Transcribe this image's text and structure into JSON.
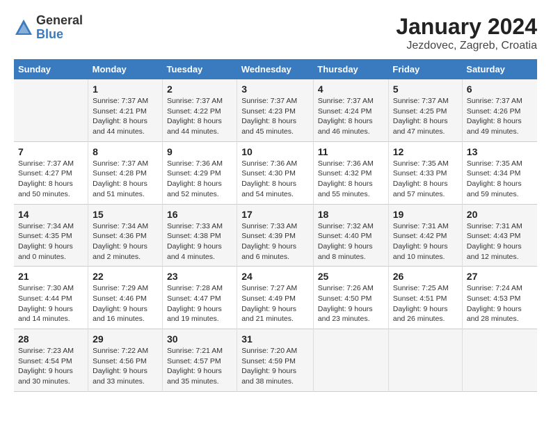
{
  "logo": {
    "general": "General",
    "blue": "Blue"
  },
  "title": "January 2024",
  "subtitle": "Jezdovec, Zagreb, Croatia",
  "days_of_week": [
    "Sunday",
    "Monday",
    "Tuesday",
    "Wednesday",
    "Thursday",
    "Friday",
    "Saturday"
  ],
  "weeks": [
    [
      {
        "day": "",
        "info": ""
      },
      {
        "day": "1",
        "info": "Sunrise: 7:37 AM\nSunset: 4:21 PM\nDaylight: 8 hours\nand 44 minutes."
      },
      {
        "day": "2",
        "info": "Sunrise: 7:37 AM\nSunset: 4:22 PM\nDaylight: 8 hours\nand 44 minutes."
      },
      {
        "day": "3",
        "info": "Sunrise: 7:37 AM\nSunset: 4:23 PM\nDaylight: 8 hours\nand 45 minutes."
      },
      {
        "day": "4",
        "info": "Sunrise: 7:37 AM\nSunset: 4:24 PM\nDaylight: 8 hours\nand 46 minutes."
      },
      {
        "day": "5",
        "info": "Sunrise: 7:37 AM\nSunset: 4:25 PM\nDaylight: 8 hours\nand 47 minutes."
      },
      {
        "day": "6",
        "info": "Sunrise: 7:37 AM\nSunset: 4:26 PM\nDaylight: 8 hours\nand 49 minutes."
      }
    ],
    [
      {
        "day": "7",
        "info": "Sunrise: 7:37 AM\nSunset: 4:27 PM\nDaylight: 8 hours\nand 50 minutes."
      },
      {
        "day": "8",
        "info": "Sunrise: 7:37 AM\nSunset: 4:28 PM\nDaylight: 8 hours\nand 51 minutes."
      },
      {
        "day": "9",
        "info": "Sunrise: 7:36 AM\nSunset: 4:29 PM\nDaylight: 8 hours\nand 52 minutes."
      },
      {
        "day": "10",
        "info": "Sunrise: 7:36 AM\nSunset: 4:30 PM\nDaylight: 8 hours\nand 54 minutes."
      },
      {
        "day": "11",
        "info": "Sunrise: 7:36 AM\nSunset: 4:32 PM\nDaylight: 8 hours\nand 55 minutes."
      },
      {
        "day": "12",
        "info": "Sunrise: 7:35 AM\nSunset: 4:33 PM\nDaylight: 8 hours\nand 57 minutes."
      },
      {
        "day": "13",
        "info": "Sunrise: 7:35 AM\nSunset: 4:34 PM\nDaylight: 8 hours\nand 59 minutes."
      }
    ],
    [
      {
        "day": "14",
        "info": "Sunrise: 7:34 AM\nSunset: 4:35 PM\nDaylight: 9 hours\nand 0 minutes."
      },
      {
        "day": "15",
        "info": "Sunrise: 7:34 AM\nSunset: 4:36 PM\nDaylight: 9 hours\nand 2 minutes."
      },
      {
        "day": "16",
        "info": "Sunrise: 7:33 AM\nSunset: 4:38 PM\nDaylight: 9 hours\nand 4 minutes."
      },
      {
        "day": "17",
        "info": "Sunrise: 7:33 AM\nSunset: 4:39 PM\nDaylight: 9 hours\nand 6 minutes."
      },
      {
        "day": "18",
        "info": "Sunrise: 7:32 AM\nSunset: 4:40 PM\nDaylight: 9 hours\nand 8 minutes."
      },
      {
        "day": "19",
        "info": "Sunrise: 7:31 AM\nSunset: 4:42 PM\nDaylight: 9 hours\nand 10 minutes."
      },
      {
        "day": "20",
        "info": "Sunrise: 7:31 AM\nSunset: 4:43 PM\nDaylight: 9 hours\nand 12 minutes."
      }
    ],
    [
      {
        "day": "21",
        "info": "Sunrise: 7:30 AM\nSunset: 4:44 PM\nDaylight: 9 hours\nand 14 minutes."
      },
      {
        "day": "22",
        "info": "Sunrise: 7:29 AM\nSunset: 4:46 PM\nDaylight: 9 hours\nand 16 minutes."
      },
      {
        "day": "23",
        "info": "Sunrise: 7:28 AM\nSunset: 4:47 PM\nDaylight: 9 hours\nand 19 minutes."
      },
      {
        "day": "24",
        "info": "Sunrise: 7:27 AM\nSunset: 4:49 PM\nDaylight: 9 hours\nand 21 minutes."
      },
      {
        "day": "25",
        "info": "Sunrise: 7:26 AM\nSunset: 4:50 PM\nDaylight: 9 hours\nand 23 minutes."
      },
      {
        "day": "26",
        "info": "Sunrise: 7:25 AM\nSunset: 4:51 PM\nDaylight: 9 hours\nand 26 minutes."
      },
      {
        "day": "27",
        "info": "Sunrise: 7:24 AM\nSunset: 4:53 PM\nDaylight: 9 hours\nand 28 minutes."
      }
    ],
    [
      {
        "day": "28",
        "info": "Sunrise: 7:23 AM\nSunset: 4:54 PM\nDaylight: 9 hours\nand 30 minutes."
      },
      {
        "day": "29",
        "info": "Sunrise: 7:22 AM\nSunset: 4:56 PM\nDaylight: 9 hours\nand 33 minutes."
      },
      {
        "day": "30",
        "info": "Sunrise: 7:21 AM\nSunset: 4:57 PM\nDaylight: 9 hours\nand 35 minutes."
      },
      {
        "day": "31",
        "info": "Sunrise: 7:20 AM\nSunset: 4:59 PM\nDaylight: 9 hours\nand 38 minutes."
      },
      {
        "day": "",
        "info": ""
      },
      {
        "day": "",
        "info": ""
      },
      {
        "day": "",
        "info": ""
      }
    ]
  ]
}
